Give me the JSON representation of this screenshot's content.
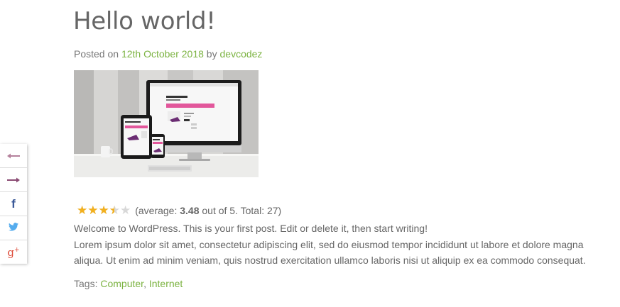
{
  "post": {
    "title": "Hello world!",
    "meta_prefix": "Posted on ",
    "date": "12th October 2018",
    "meta_by": " by ",
    "author": "devcodez"
  },
  "thumbnail": {
    "screen_brand": "ONLINE SHOP",
    "tablet_brand": "ONLINE SHOP",
    "phone_brand": "SHOP"
  },
  "rating": {
    "average_value": 3.48,
    "text_prefix": "(average: ",
    "average": "3.48",
    "text_suffix": " out of 5. Total: 27)",
    "colors": {
      "filled": "#f2b01e",
      "empty": "#d8d8d8"
    }
  },
  "content": {
    "paragraph1": "Welcome to WordPress. This is your first post. Edit or delete it, then start writing!",
    "paragraph2": "Lorem ipsum dolor sit amet, consectetur adipiscing elit, sed do eiusmod tempor incididunt ut labore et dolore magna aliqua. Ut enim ad minim veniam, quis nostrud exercitation ullamco laboris nisi ut aliquip ex ea commodo consequat."
  },
  "tags": {
    "label": "Tags: ",
    "items": [
      "Computer",
      "Internet"
    ],
    "separator": ", "
  },
  "share": {
    "buttons": [
      "arrow-left-icon",
      "arrow-right-icon",
      "facebook-icon",
      "twitter-icon",
      "google-plus-icon"
    ],
    "colors": {
      "arrows": "#a0557a",
      "facebook": "#3b5998",
      "twitter": "#55acee",
      "google": "#dd4b39"
    }
  },
  "colors": {
    "link": "#7cb342",
    "text": "#666666"
  }
}
